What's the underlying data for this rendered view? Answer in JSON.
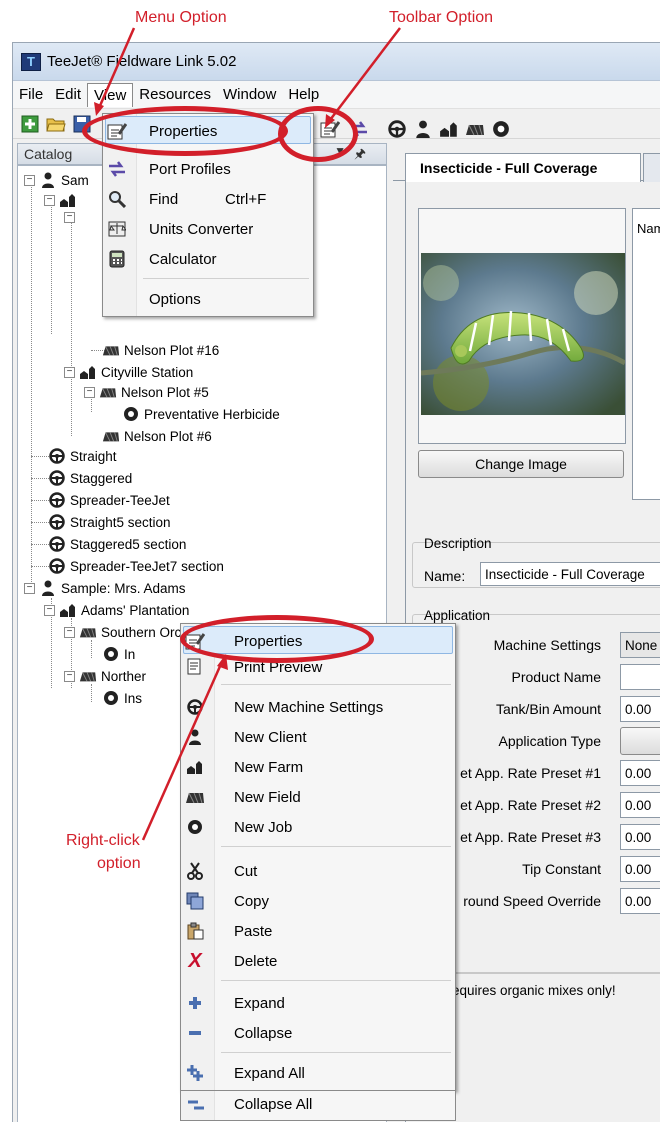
{
  "callouts": {
    "menu_option": "Menu Option",
    "toolbar_option": "Toolbar Option",
    "right_click_line1": "Right-click",
    "right_click_line2": "option",
    "accent_color": "#d21f2a"
  },
  "window": {
    "title": "TeeJet® Fieldware Link 5.02",
    "app_icon": "teejet-logo-icon"
  },
  "menubar": {
    "items": [
      "File",
      "Edit",
      "View",
      "Resources",
      "Window",
      "Help"
    ],
    "active": "View"
  },
  "toolbar": {
    "icons": [
      "add-icon",
      "open-folder-icon",
      "save-icon",
      "properties-icon",
      "port-profiles-icon",
      "steering-wheel-icon",
      "client-icon",
      "farm-icon",
      "field-icon",
      "job-icon"
    ]
  },
  "view_menu": {
    "items": [
      {
        "label": "Properties",
        "icon": "properties-icon",
        "shortcut": ""
      },
      {
        "label": "Port Profiles",
        "icon": "port-profiles-icon",
        "shortcut": ""
      },
      {
        "label": "Find",
        "icon": "magnifier-icon",
        "shortcut": "Ctrl+F"
      },
      {
        "label": "Units Converter",
        "icon": "scale-icon",
        "shortcut": ""
      },
      {
        "label": "Calculator",
        "icon": "calculator-icon",
        "shortcut": ""
      },
      {
        "label": "Options",
        "icon": "",
        "shortcut": ""
      }
    ]
  },
  "catalog": {
    "header": "Catalog",
    "nodes": [
      {
        "label": "Sam",
        "type": "client"
      },
      {
        "label": "Nelson Plot #16",
        "type": "field"
      },
      {
        "label": "Cityville Station",
        "type": "farm"
      },
      {
        "label": "Nelson Plot #5",
        "type": "field"
      },
      {
        "label": "Preventative Herbicide",
        "type": "job"
      },
      {
        "label": "Nelson Plot #6",
        "type": "field"
      },
      {
        "label": "Straight",
        "type": "machine"
      },
      {
        "label": "Staggered",
        "type": "machine"
      },
      {
        "label": "Spreader-TeeJet",
        "type": "machine"
      },
      {
        "label": "Straight5 section",
        "type": "machine"
      },
      {
        "label": "Staggered5 section",
        "type": "machine"
      },
      {
        "label": "Spreader-TeeJet7 section",
        "type": "machine"
      },
      {
        "label": "Sample: Mrs. Adams",
        "type": "client"
      },
      {
        "label": "Adams' Plantation",
        "type": "farm"
      },
      {
        "label": "Southern Orchard",
        "type": "field"
      },
      {
        "label": "In",
        "type": "job"
      },
      {
        "label": "Norther",
        "type": "field"
      },
      {
        "label": "Ins",
        "type": "job"
      }
    ]
  },
  "document": {
    "tab_label": "Insecticide - Full Coverage",
    "name_column_header": "Name",
    "change_image_button": "Change Image",
    "description_group": "Description",
    "name_label": "Name:",
    "name_value": "Insecticide - Full Coverage",
    "application_group": "Application",
    "fields": [
      {
        "label": "Machine Settings",
        "value": "None"
      },
      {
        "label": "Product Name",
        "value": ""
      },
      {
        "label": "Tank/Bin Amount",
        "value": "0.00"
      },
      {
        "label": "Application Type",
        "value": ""
      },
      {
        "label": "et App. Rate Preset #1",
        "value": "0.00"
      },
      {
        "label": "et App. Rate Preset #2",
        "value": "0.00"
      },
      {
        "label": "et App. Rate Preset #3",
        "value": "0.00"
      },
      {
        "label": "Tip Constant",
        "value": "0.00"
      },
      {
        "label": "round Speed Override",
        "value": "0.00"
      }
    ],
    "notes": "equires organic mixes only!"
  },
  "context_menu": {
    "items": [
      {
        "label": "Properties",
        "icon": "properties-icon"
      },
      {
        "label": "Print Preview",
        "icon": "print-preview-icon"
      },
      {
        "label": "New Machine Settings",
        "icon": "steering-wheel-icon"
      },
      {
        "label": "New Client",
        "icon": "client-icon"
      },
      {
        "label": "New Farm",
        "icon": "farm-icon"
      },
      {
        "label": "New Field",
        "icon": "field-icon"
      },
      {
        "label": "New Job",
        "icon": "job-icon"
      },
      {
        "label": "Cut",
        "icon": "scissors-icon"
      },
      {
        "label": "Copy",
        "icon": "copy-icon"
      },
      {
        "label": "Paste",
        "icon": "paste-icon"
      },
      {
        "label": "Delete",
        "icon": "delete-icon"
      },
      {
        "label": "Expand",
        "icon": "expand-icon"
      },
      {
        "label": "Collapse",
        "icon": "collapse-icon"
      },
      {
        "label": "Expand All",
        "icon": "expand-all-icon"
      },
      {
        "label": "Collapse All",
        "icon": "collapse-all-icon"
      }
    ]
  }
}
